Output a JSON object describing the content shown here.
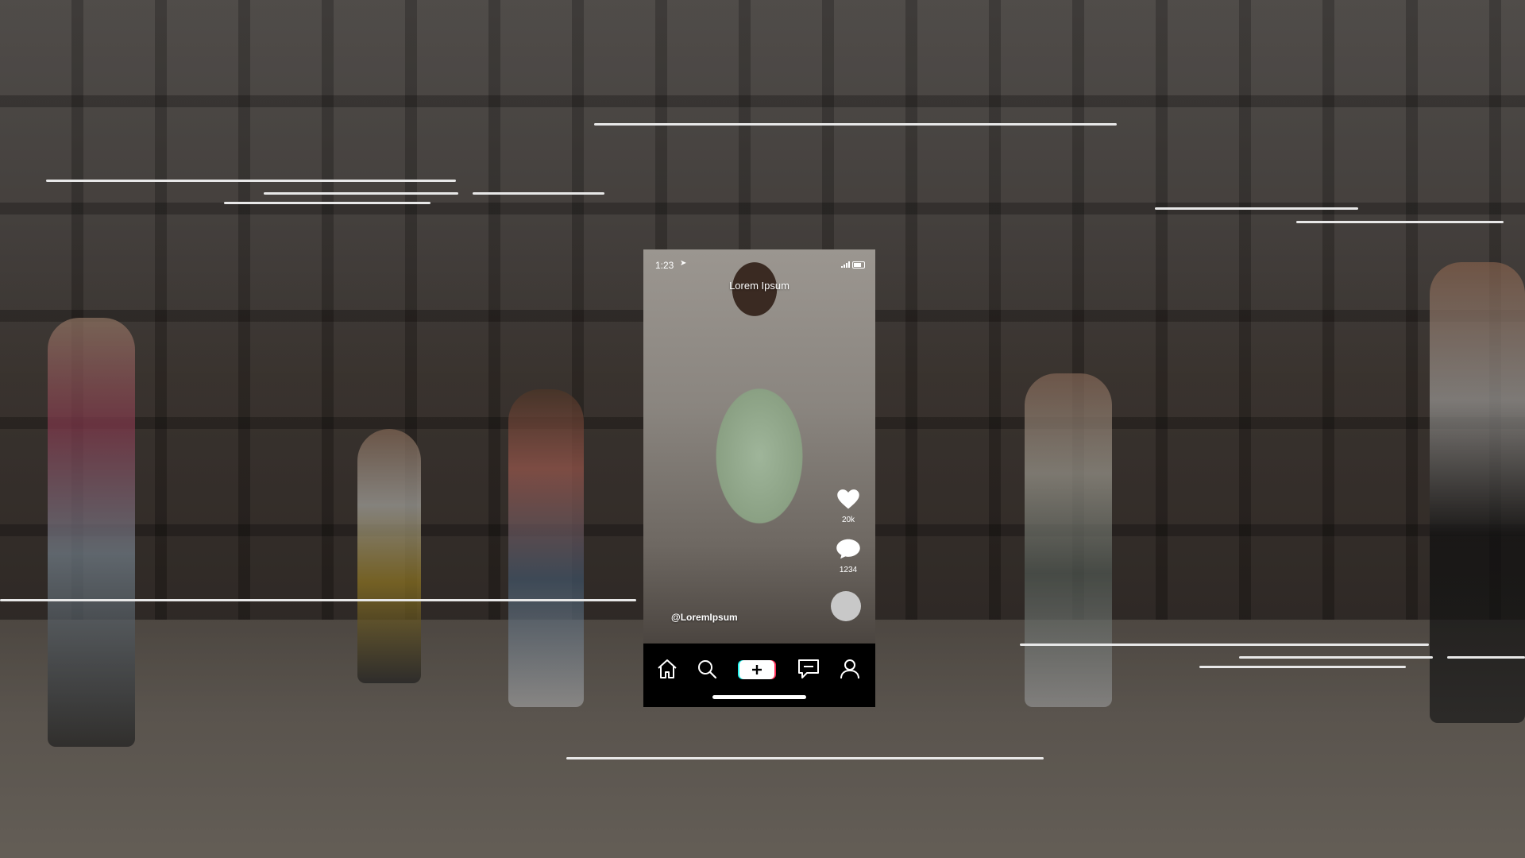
{
  "phone": {
    "status_time": "1:23",
    "video_title": "Lorem Ipsum",
    "username": "@LoremIpsum",
    "likes_count": "20k",
    "comments_count": "1234"
  },
  "icons": {
    "nav": [
      "home-icon",
      "search-icon",
      "create-icon",
      "inbox-icon",
      "profile-icon"
    ],
    "actions": [
      "heart-icon",
      "comment-icon"
    ]
  },
  "colors": {
    "nav_bar": "#000000",
    "create_accent_left": "#25f4ee",
    "create_accent_right": "#fe2c55",
    "overlay_line": "#e8e8e8"
  }
}
